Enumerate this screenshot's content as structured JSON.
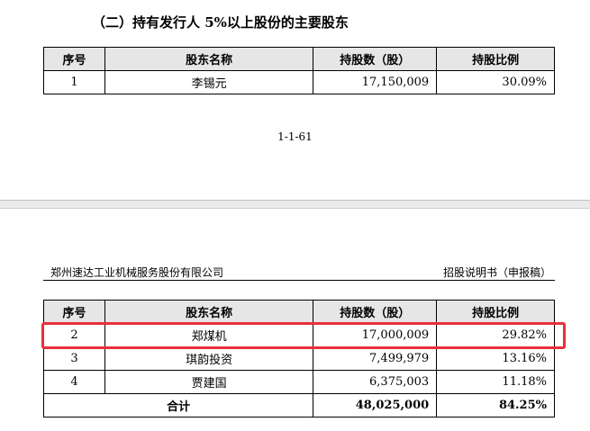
{
  "section_title": "（二）持有发行人 5%以上股份的主要股东",
  "columns": [
    "序号",
    "股东名称",
    "持股数（股）",
    "持股比例"
  ],
  "table_top_rows": [
    [
      "1",
      "李锡元",
      "17,150,009",
      "30.09%"
    ]
  ],
  "page_number": "1-1-61",
  "header": {
    "company": "郑州速达工业机械服务股份有限公司",
    "document": "招股说明书（申报稿）"
  },
  "table_bottom_rows": [
    [
      "2",
      "郑煤机",
      "17,000,009",
      "29.82%"
    ],
    [
      "3",
      "琪韵投资",
      "7,499,979",
      "13.16%"
    ],
    [
      "4",
      "贾建国",
      "6,375,003",
      "11.18%"
    ]
  ],
  "total": {
    "label": "合计",
    "shares": "48,025,000",
    "ratio": "84.25%"
  },
  "highlight_color": "#e8303a"
}
